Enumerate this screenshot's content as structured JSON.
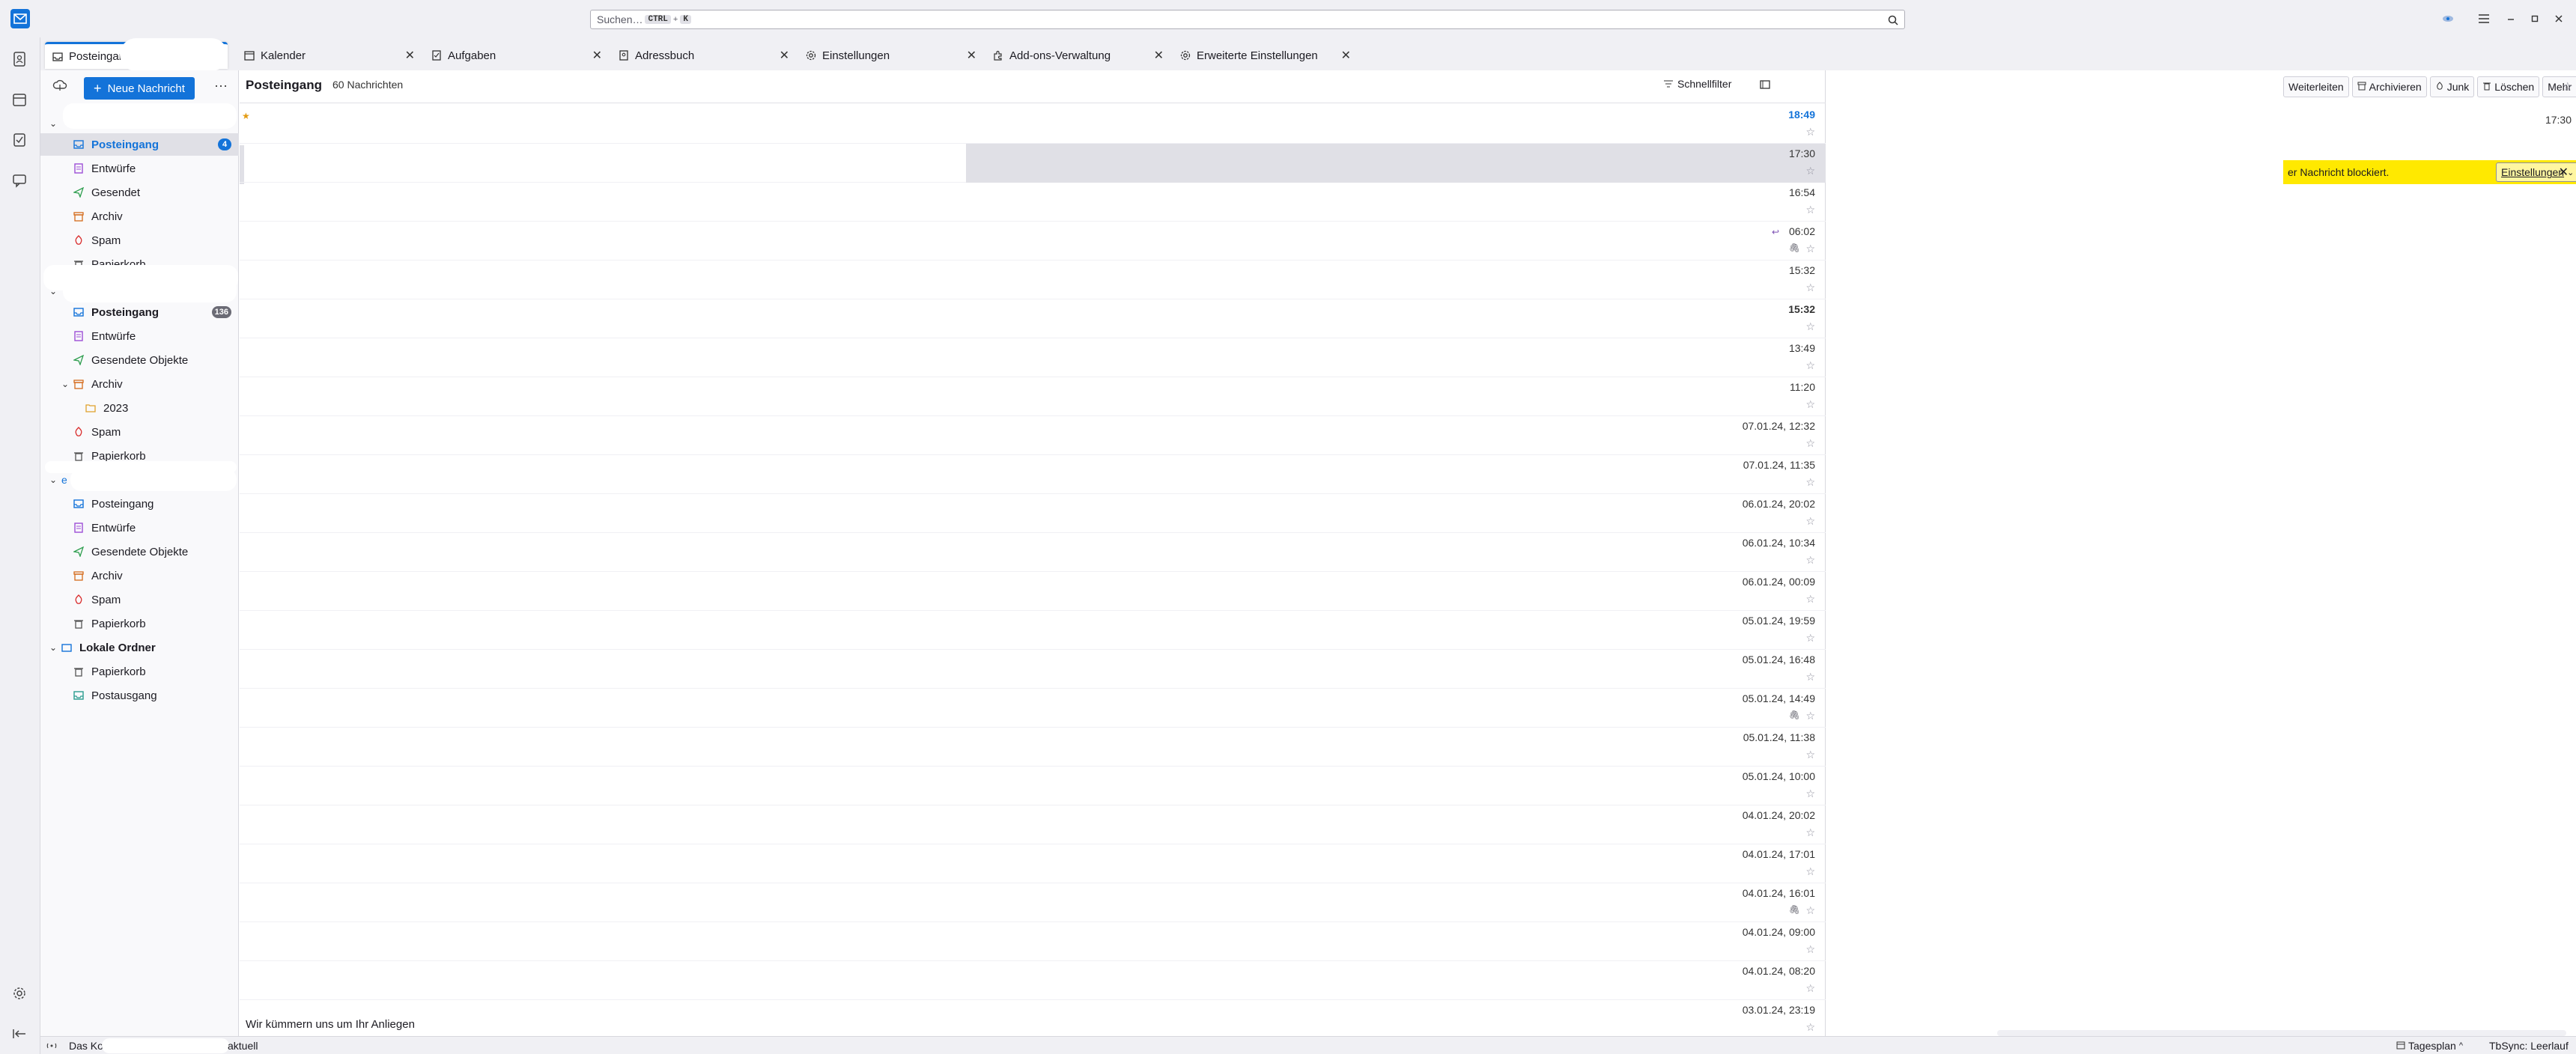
{
  "app": {
    "search_placeholder": "Suchen…",
    "search_shortcut_1": "CTRL",
    "search_shortcut_sep": "+",
    "search_shortcut_2": "K"
  },
  "tabs": [
    {
      "label": "Posteingang",
      "icon": "inbox-icon"
    },
    {
      "label": "Kalender",
      "icon": "calendar-icon"
    },
    {
      "label": "Aufgaben",
      "icon": "tasks-icon"
    },
    {
      "label": "Adressbuch",
      "icon": "addressbook-icon"
    },
    {
      "label": "Einstellungen",
      "icon": "gear-icon"
    },
    {
      "label": "Add-ons-Verwaltung",
      "icon": "puzzle-icon"
    },
    {
      "label": "Erweiterte Einstellungen",
      "icon": "gear-icon"
    }
  ],
  "folderpane": {
    "new_message": "Neue Nachricht",
    "more": "···",
    "account1": {
      "folders": [
        {
          "label": "Posteingang",
          "badge": "4",
          "icon": "inbox-icon"
        },
        {
          "label": "Entwürfe",
          "icon": "drafts-icon"
        },
        {
          "label": "Gesendet",
          "icon": "sent-icon"
        },
        {
          "label": "Archiv",
          "icon": "archive-icon"
        },
        {
          "label": "Spam",
          "icon": "spam-icon"
        },
        {
          "label": "Papierkorb",
          "icon": "trash-icon"
        }
      ]
    },
    "account2": {
      "folders": [
        {
          "label": "Posteingang",
          "badge": "136",
          "icon": "inbox-icon"
        },
        {
          "label": "Entwürfe",
          "icon": "drafts-icon"
        },
        {
          "label": "Gesendete Objekte",
          "icon": "sent-icon"
        },
        {
          "label": "Archiv",
          "icon": "archive-icon"
        },
        {
          "label": "2023",
          "icon": "folder-icon"
        },
        {
          "label": "Spam",
          "icon": "spam-icon"
        },
        {
          "label": "Papierkorb",
          "icon": "trash-icon"
        }
      ]
    },
    "account3": {
      "name_prefix": "e",
      "folders": [
        {
          "label": "Posteingang",
          "icon": "inbox-icon"
        },
        {
          "label": "Entwürfe",
          "icon": "drafts-icon"
        },
        {
          "label": "Gesendete Objekte",
          "icon": "sent-icon"
        },
        {
          "label": "Archiv",
          "icon": "archive-icon"
        },
        {
          "label": "Spam",
          "icon": "spam-icon"
        },
        {
          "label": "Papierkorb",
          "icon": "trash-icon"
        }
      ]
    },
    "local": {
      "name": "Lokale Ordner",
      "folders": [
        {
          "label": "Papierkorb",
          "icon": "trash-icon"
        },
        {
          "label": "Postausgang",
          "icon": "outbox-icon"
        }
      ]
    }
  },
  "threadpane": {
    "title": "Posteingang",
    "count": "60 Nachrichten",
    "quick_filter": "Schnellfilter",
    "messages": [
      {
        "date": "18:49",
        "style": "blue",
        "star": "☆"
      },
      {
        "date": "17:30",
        "style": "normal",
        "star": "☆"
      },
      {
        "date": "16:54",
        "style": "normal",
        "star": "☆"
      },
      {
        "date": "06:02",
        "style": "normal",
        "star": "☆"
      },
      {
        "date": "15:32",
        "style": "normal",
        "star": "☆"
      },
      {
        "date": "15:32",
        "style": "bold",
        "star": "☆"
      },
      {
        "date": "13:49",
        "style": "normal",
        "star": "☆"
      },
      {
        "date": "11:20",
        "style": "normal",
        "star": "☆"
      },
      {
        "date": "07.01.24, 12:32",
        "style": "normal",
        "star": "☆"
      },
      {
        "date": "07.01.24, 11:35",
        "style": "normal",
        "star": "☆"
      },
      {
        "date": "06.01.24, 20:02",
        "style": "normal",
        "star": "☆"
      },
      {
        "date": "06.01.24, 10:34",
        "style": "normal",
        "star": "☆"
      },
      {
        "date": "06.01.24, 00:09",
        "style": "normal",
        "star": "☆"
      },
      {
        "date": "05.01.24, 19:59",
        "style": "normal",
        "star": "☆"
      },
      {
        "date": "05.01.24, 16:48",
        "style": "normal",
        "star": "☆"
      },
      {
        "date": "05.01.24, 14:49",
        "style": "normal",
        "star": "☆"
      },
      {
        "date": "05.01.24, 11:38",
        "style": "normal",
        "star": "☆"
      },
      {
        "date": "05.01.24, 10:00",
        "style": "normal",
        "star": "☆"
      },
      {
        "date": "04.01.24, 20:02",
        "style": "normal",
        "star": "☆"
      },
      {
        "date": "04.01.24, 17:01",
        "style": "normal",
        "star": "☆"
      },
      {
        "date": "04.01.24, 16:01",
        "style": "normal",
        "star": "☆"
      },
      {
        "date": "04.01.24, 09:00",
        "style": "normal",
        "star": "☆"
      },
      {
        "date": "04.01.24, 08:20",
        "style": "normal",
        "star": "☆"
      },
      {
        "date": "03.01.24, 23:19",
        "style": "normal",
        "star": "☆"
      }
    ],
    "bottom_preview": "Wir kümmern uns um Ihr Anliegen"
  },
  "msgpane": {
    "buttons": [
      "Weiterleiten",
      "Archivieren",
      "Junk",
      "Löschen",
      "Mehr"
    ],
    "time": "17:30",
    "notification": "er Nachricht blockiert.",
    "notification_button": "Einstellungen",
    "notification_close": "✕"
  },
  "statusbar": {
    "text1": "Das Ko",
    "text2": "aktuell",
    "agenda": "Tagesplan",
    "sync": "TbSync: Leerlauf"
  },
  "colors": {
    "accent": "#1373d9",
    "notification": "#ffe900"
  }
}
